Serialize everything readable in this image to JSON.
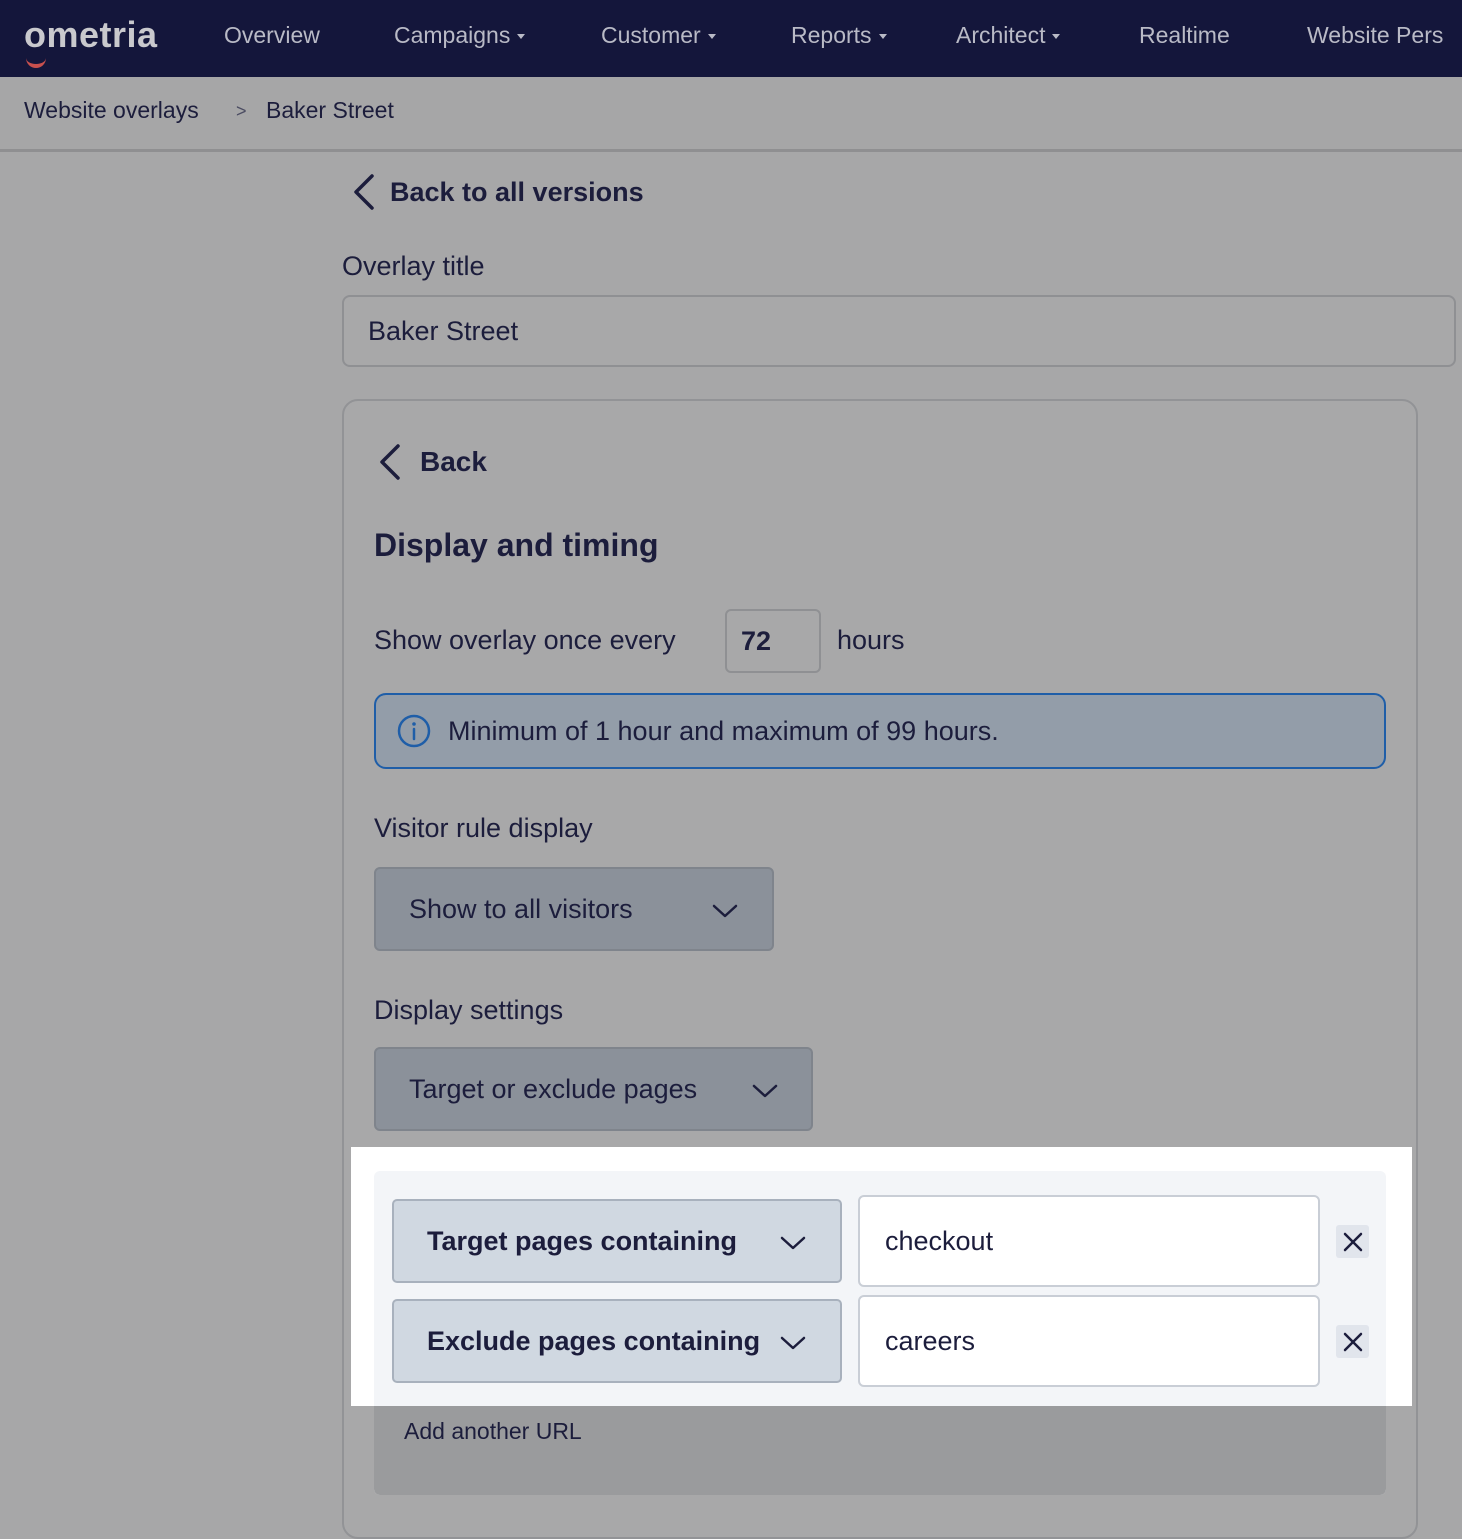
{
  "nav": {
    "logo": "ometria",
    "items": [
      {
        "label": "Overview",
        "dropdown": false
      },
      {
        "label": "Campaigns",
        "dropdown": true
      },
      {
        "label": "Customer",
        "dropdown": true
      },
      {
        "label": "Reports",
        "dropdown": true
      },
      {
        "label": "Architect",
        "dropdown": true
      },
      {
        "label": "Realtime",
        "dropdown": false
      },
      {
        "label": "Website Pers",
        "dropdown": false
      }
    ]
  },
  "breadcrumb": {
    "parent": "Website overlays",
    "separator": ">",
    "current": "Baker Street"
  },
  "back_to_versions": "Back to all versions",
  "overlay_title": {
    "label": "Overlay title",
    "value": "Baker Street"
  },
  "panel": {
    "back_label": "Back",
    "section_title": "Display and timing",
    "frequency": {
      "prefix": "Show overlay once every",
      "value": "72",
      "suffix": "hours"
    },
    "info": "Minimum of 1 hour and maximum of 99 hours.",
    "visitor_rule": {
      "label": "Visitor rule display",
      "selected": "Show to all visitors"
    },
    "display_settings": {
      "label": "Display settings",
      "selected": "Target or exclude pages"
    },
    "rules": [
      {
        "type": "Target pages containing",
        "value": "checkout"
      },
      {
        "type": "Exclude pages containing",
        "value": "careers"
      }
    ],
    "add_url": "Add another URL"
  },
  "colors": {
    "nav_bg": "#14163b",
    "info_border": "#1f5ea8",
    "logo_accent": "#c8504e"
  },
  "icons": [
    "chevron-left-icon",
    "info-icon",
    "chevron-down-icon",
    "close-icon"
  ]
}
